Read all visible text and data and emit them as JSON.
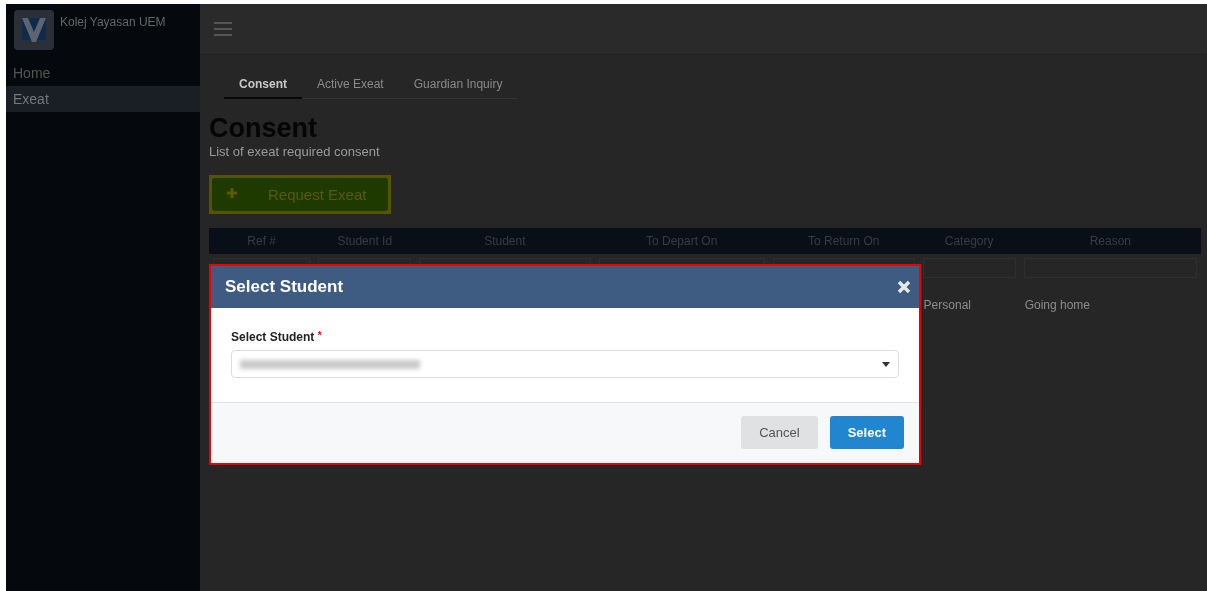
{
  "sidebar": {
    "brand": "Kolej Yayasan UEM",
    "items": [
      {
        "label": "Home",
        "selected": false
      },
      {
        "label": "Exeat",
        "selected": true
      }
    ]
  },
  "tabs": [
    {
      "label": "Consent",
      "selected": true
    },
    {
      "label": "Active Exeat",
      "selected": false
    },
    {
      "label": "Guardian Inquiry",
      "selected": false
    }
  ],
  "page": {
    "title": "Consent",
    "subtitle": "List of exeat required consent",
    "action": "Request Exeat"
  },
  "table": {
    "columns": [
      "Ref #",
      "Student Id",
      "Student",
      "To Depart On",
      "To Return On",
      "Category",
      "Reason"
    ],
    "rows": [
      [
        "",
        "",
        "",
        "",
        "",
        "Personal",
        "Going home"
      ]
    ]
  },
  "dialog": {
    "title": "Select Student",
    "field_label": "Select Student",
    "required_mark": "*",
    "buttons": [
      {
        "label": "Cancel",
        "kind": "secondary"
      },
      {
        "label": "Select",
        "kind": "primary"
      }
    ]
  }
}
